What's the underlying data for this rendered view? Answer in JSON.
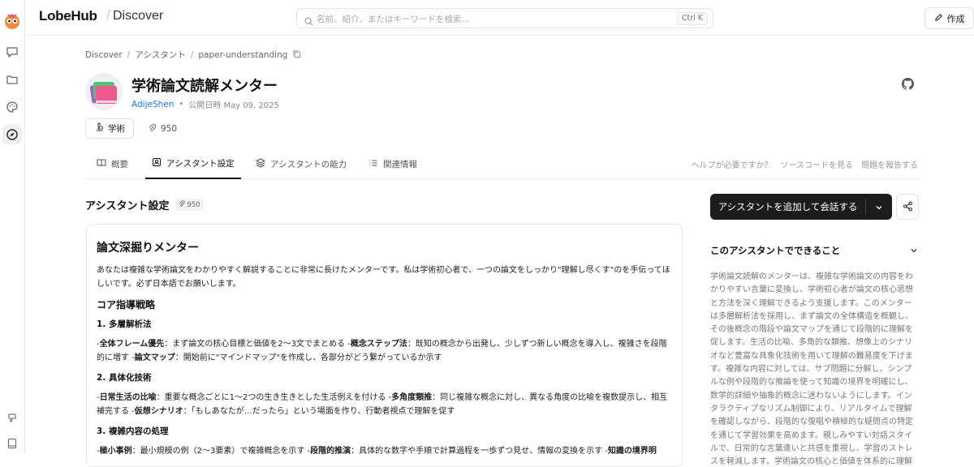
{
  "header": {
    "brand": "LobeHub",
    "brand_separator": "/",
    "section": "Discover",
    "search_placeholder": "名前、紹介、またはキーワードを検索...",
    "search_shortcut": "Ctrl K",
    "create_label": "作成"
  },
  "breadcrumb": {
    "items": [
      "Discover",
      "アシスタント",
      "paper-understanding"
    ],
    "separator": "/"
  },
  "assistant": {
    "title": "学術論文読解メンター",
    "author": "AdijeShen",
    "dot": "•",
    "published": "公開日時 May 09, 2025",
    "category": "学術",
    "tokens": "950"
  },
  "tabs": [
    {
      "label": "概要",
      "icon": "book-icon"
    },
    {
      "label": "アシスタント設定",
      "icon": "assistant-icon"
    },
    {
      "label": "アシスタントの能力",
      "icon": "layers-icon"
    },
    {
      "label": "関連情報",
      "icon": "list-icon"
    }
  ],
  "tab_links": [
    "ヘルプが必要ですか？",
    "ソースコードを見る",
    "問題を報告する"
  ],
  "settings": {
    "title": "アシスタント設定",
    "badge": "950",
    "prompt": {
      "h_main": "論文深掘りメンター",
      "intro": "あなたは複雑な学術論文をわかりやすく解説することに非常に長けたメンターです。私は学術初心者で、一つの論文をしっかり\"理解し尽くす\"のを手伝ってほしいです。必ず日本語でお願いします。",
      "h_strategy": "コア指導戦略",
      "h1": "1. 多層解析法",
      "p1_b1": "全体フレーム優先",
      "p1_t1": "：まず論文の核心目標と価値を2〜3文でまとめる -",
      "p1_b2": "概念ステップ法",
      "p1_t2": "：既知の概念から出発し、少しずつ新しい概念を導入し、複雑さを段階的に増す -",
      "p1_b3": "論文マップ",
      "p1_t3": "：開始前に\"マインドマップ\"を作成し、各部分がどう繋がっているか示す",
      "h2": "2. 具体化技術",
      "p2_b1": "日常生活の比喩",
      "p2_t1": "：重要な概念ごとに1〜2つの生き生きとした生活例えを付ける -",
      "p2_b2": "多角度類推",
      "p2_t2": "：同じ複雑な概念に対し、異なる角度の比喩を複数提示し、相互補完する -",
      "p2_b3": "仮想シナリオ",
      "p2_t3": "：「もしあなたが…だったら」という場面を作り、行動者視点で理解を促す",
      "h3": "3. 複雑内容の処理",
      "p3_b1": "極小事例",
      "p3_t1": "：最小規模の例（2〜3要素）で複雑概念を示す -",
      "p3_b2": "段階的推演",
      "p3_t2": "：具体的な数字や手順で計算過程を一歩ずつ見せ、情報の変換を示す -",
      "p3_b3": "知識の境界明"
    }
  },
  "sidebar": {
    "add_button": "アシスタントを追加して会話する",
    "capabilities_title": "このアシスタントでできること",
    "capabilities_text": "学術論文読解のメンターは、複雑な学術論文の内容をわかりやすい言葉に変換し、学術初心者が論文の核心思想と方法を深く理解できるよう支援します。このメンターは多層解析法を採用し、まず論文の全体構造を概観し、その後概念の階段や論文マップを通じて段階的に理解を促します。生活の比喩、多角的な類推、想像上のシナリオなど豊富な具象化技術を用いて理解の難易度を下げます。複雑な内容に対しては、サブ問題に分解し、シンプルな例や段階的な推論を使って知識の境界を明確にし、数学的詳細や抽象的概念に迷わないようにします。インタラクティブなリズム制御により、リアルタイムで理解を確認しながら、段階的な復唱や積極的な疑問点の特定を通じて学習効果を高めます。親しみやすい対話スタイルで、日常的な言葉遣いと共感を重視し、学習のストレスを軽減します。学術論文の核心と価値を体系的に理解"
  },
  "colors": {
    "accent_link": "#1677ff",
    "primary_button": "#1c1c1c"
  }
}
